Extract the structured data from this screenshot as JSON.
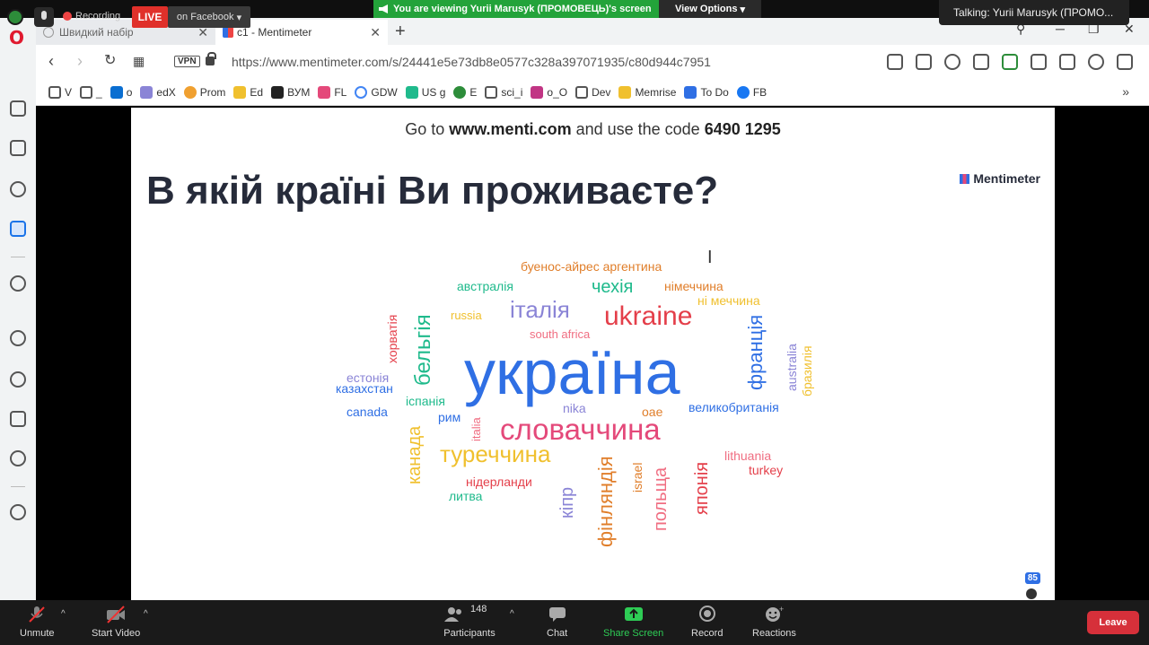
{
  "zoom": {
    "recording": "Recording",
    "live_badge": "LIVE",
    "live_target": "on Facebook",
    "share_banner": "You are viewing Yurii Marusyk (ПРОМОВЕЦЬ)'s screen",
    "view_options": "View Options",
    "talking": "Talking: Yurii Marusyk (ПРОМО...",
    "toolbar": {
      "unmute": "Unmute",
      "start_video": "Start Video",
      "participants": "Participants",
      "participants_count": "148",
      "chat": "Chat",
      "share_screen": "Share Screen",
      "record": "Record",
      "reactions": "Reactions",
      "leave": "Leave"
    }
  },
  "browser": {
    "tabs": [
      {
        "label": "Швидкий набір"
      },
      {
        "label": "c1 - Mentimeter"
      }
    ],
    "vpn": "VPN",
    "url": "https://www.mentimeter.com/s/24441e5e73db8e0577c328a397071935/c80d944c7951",
    "bookmarks": [
      "V",
      "_",
      "o",
      "edX",
      "Prom",
      "Ed",
      "ВУМ",
      "FL",
      "GDW",
      "US g",
      "E",
      "sci_i",
      "o_O",
      "Dev",
      "Memrise",
      "To Do",
      "FB"
    ],
    "bookmarks_more": "»"
  },
  "slide": {
    "join_prefix": "Go to ",
    "join_site": "www.menti.com",
    "join_mid": " and use the code ",
    "join_code": "6490 1295",
    "title": "В якій країні Ви проживаєте?",
    "brand": "Mentimeter",
    "participant_count": "85"
  },
  "word_cloud": [
    {
      "text": "україна",
      "color": "#2f6fe4"
    },
    {
      "text": "словаччина",
      "color": "#e4497a"
    },
    {
      "text": "ukraine",
      "color": "#e43f4a"
    },
    {
      "text": "італія",
      "color": "#8a84d6"
    },
    {
      "text": "туреччина",
      "color": "#f0c02e"
    },
    {
      "text": "бельгія",
      "color": "#1fba8c"
    },
    {
      "text": "франція",
      "color": "#2f6fe4"
    },
    {
      "text": "чехія",
      "color": "#1fba8c"
    },
    {
      "text": "буенос-айрес аргентина",
      "color": "#e07e2a"
    },
    {
      "text": "австралія",
      "color": "#1fba8c"
    },
    {
      "text": "німеччина",
      "color": "#e07e2a"
    },
    {
      "text": "ні меччина",
      "color": "#f0c02e"
    },
    {
      "text": "russia",
      "color": "#f0c02e"
    },
    {
      "text": "south africa",
      "color": "#f06e82"
    },
    {
      "text": "хорватія",
      "color": "#e43f4a"
    },
    {
      "text": "естонія",
      "color": "#8a84d6"
    },
    {
      "text": "казахстан",
      "color": "#2f6fe4"
    },
    {
      "text": "іспанія",
      "color": "#1fba8c"
    },
    {
      "text": "canada",
      "color": "#2f6fe4"
    },
    {
      "text": "рим",
      "color": "#2f6fe4"
    },
    {
      "text": "nika",
      "color": "#8a84d6"
    },
    {
      "text": "оае",
      "color": "#e07e2a"
    },
    {
      "text": "великобританія",
      "color": "#2f6fe4"
    },
    {
      "text": "australia",
      "color": "#8a84d6"
    },
    {
      "text": "бразилія",
      "color": "#f0c02e"
    },
    {
      "text": "канада",
      "color": "#f0c02e"
    },
    {
      "text": "italia",
      "color": "#f06e82"
    },
    {
      "text": "нідерланди",
      "color": "#e43f4a"
    },
    {
      "text": "литва",
      "color": "#1fba8c"
    },
    {
      "text": "кіпр",
      "color": "#8a84d6"
    },
    {
      "text": "фінляндія",
      "color": "#e07e2a"
    },
    {
      "text": "israel",
      "color": "#e07e2a"
    },
    {
      "text": "польща",
      "color": "#f06e82"
    },
    {
      "text": "японія",
      "color": "#e43f4a"
    },
    {
      "text": "lithuania",
      "color": "#f06e82"
    },
    {
      "text": "turkey",
      "color": "#e43f4a"
    }
  ]
}
